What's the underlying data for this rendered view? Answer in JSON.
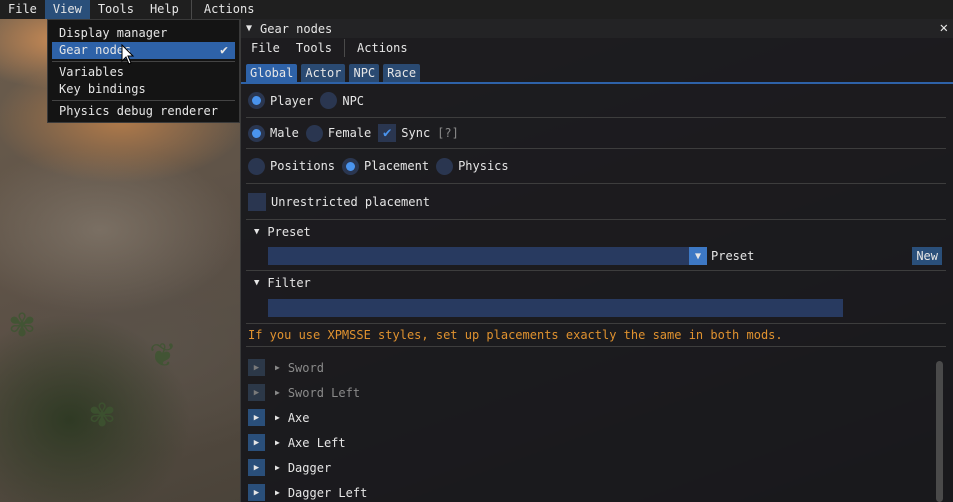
{
  "menubar": {
    "items": [
      "File",
      "View",
      "Tools",
      "Help"
    ],
    "actions": "Actions",
    "active": "View"
  },
  "view_menu": {
    "items": [
      "Display manager",
      "Gear nodes",
      "Variables",
      "Key bindings",
      "Physics debug renderer"
    ],
    "selected": "Gear nodes"
  },
  "window": {
    "title": "Gear nodes",
    "menu": [
      "File",
      "Tools"
    ],
    "actions": "Actions",
    "tabs": [
      "Global",
      "Actor",
      "NPC",
      "Race"
    ],
    "active_tab": "Global"
  },
  "target": {
    "player": "Player",
    "npc": "NPC",
    "selected": "Player"
  },
  "sex": {
    "male": "Male",
    "female": "Female",
    "selected": "Male",
    "sync_label": "Sync",
    "sync_help": "[?]",
    "sync_checked": true
  },
  "mode": {
    "options": [
      "Positions",
      "Placement",
      "Physics"
    ],
    "selected": "Placement"
  },
  "unrestricted": {
    "label": "Unrestricted placement",
    "checked": false
  },
  "preset": {
    "header": "Preset",
    "combo_label": "Preset",
    "new_button": "New",
    "value": ""
  },
  "filter": {
    "header": "Filter",
    "value": ""
  },
  "warning": "If you use XPMSSE styles, set up placements exactly the same in both mods.",
  "nodes": [
    {
      "name": "Sword",
      "enabled": false
    },
    {
      "name": "Sword Left",
      "enabled": false
    },
    {
      "name": "Axe",
      "enabled": true
    },
    {
      "name": "Axe Left",
      "enabled": true
    },
    {
      "name": "Dagger",
      "enabled": true
    },
    {
      "name": "Dagger Left",
      "enabled": true
    }
  ],
  "colors": {
    "accent": "#2e62a8",
    "warning": "#e0922f",
    "frame": "#283a60"
  }
}
